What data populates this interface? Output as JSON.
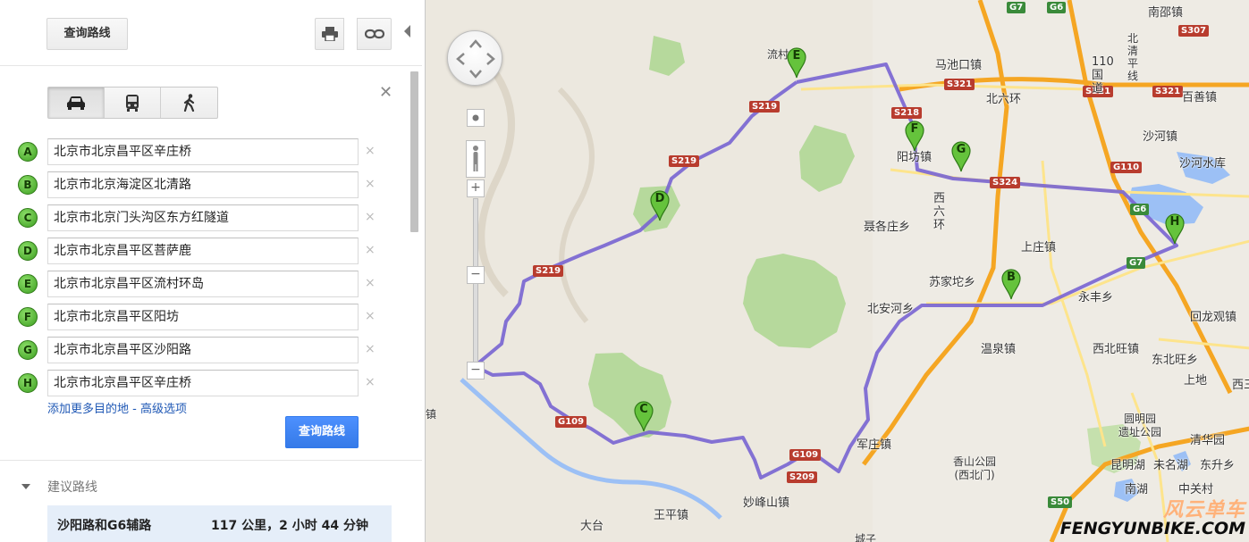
{
  "left_panel": {
    "search_button_top": "查询路线",
    "print_icon": "printer-icon",
    "link_icon": "link-icon",
    "travel_modes": [
      {
        "name": "car-icon",
        "active": true
      },
      {
        "name": "bus-icon",
        "active": false
      },
      {
        "name": "walk-icon",
        "active": false
      }
    ],
    "close_label": "✕",
    "waypoints": [
      {
        "letter": "A",
        "value": "北京市北京昌平区辛庄桥"
      },
      {
        "letter": "B",
        "value": "北京市北京海淀区北清路"
      },
      {
        "letter": "C",
        "value": "北京市北京门头沟区东方红隧道"
      },
      {
        "letter": "D",
        "value": "北京市北京昌平区菩萨鹿"
      },
      {
        "letter": "E",
        "value": "北京市北京昌平区流村环岛"
      },
      {
        "letter": "F",
        "value": "北京市北京昌平区阳坊"
      },
      {
        "letter": "G",
        "value": "北京市北京昌平区沙阳路"
      },
      {
        "letter": "H",
        "value": "北京市北京昌平区辛庄桥"
      }
    ],
    "remove_label": "×",
    "add_destination": "添加更多目的地",
    "separator": " - ",
    "advanced_options": "高级选项",
    "search_button": "查询路线",
    "suggested_routes_title": "建议路线",
    "route": {
      "name": "沙阳路和G6辅路",
      "stats": "117 公里，2 小时 44 分钟"
    }
  },
  "map": {
    "colors": {
      "route": "#7864d2",
      "highway": "#f5a623",
      "arterial": "#fde48c",
      "park": "#b6d99c",
      "water": "#9cc0f5",
      "land": "#ece8df"
    },
    "zoom_plus": "+",
    "zoom_minus_mid": "−",
    "zoom_minus": "−",
    "markers": [
      {
        "letter": "E"
      },
      {
        "letter": "F"
      },
      {
        "letter": "G"
      },
      {
        "letter": "D"
      },
      {
        "letter": "H"
      },
      {
        "letter": "B"
      },
      {
        "letter": "C"
      }
    ],
    "place_labels": [
      "流村",
      "马池口镇",
      "北六环",
      "阳坊镇",
      "聂各庄乡",
      "西六环",
      "上庄镇",
      "苏家坨乡",
      "北安河乡",
      "温泉镇",
      "永丰乡",
      "西北旺镇",
      "东北旺乡",
      "军庄镇",
      "香山公园\n(西北门)",
      "妙峰山镇",
      "王平镇",
      "大台",
      "南邵镇",
      "百善镇",
      "沙河镇",
      "沙河水库",
      "回龙观镇",
      "上地",
      "西三",
      "圆明园\n遗址公园",
      "清华园",
      "昆明湖",
      "未名湖",
      "东升乡",
      "南湖",
      "中关村",
      "110国道",
      "北清平线",
      "镇",
      "城子"
    ],
    "road_shields": [
      "G7",
      "G6",
      "S307",
      "S321",
      "S321",
      "S321",
      "S218",
      "S219",
      "S219",
      "S219",
      "S324",
      "G110",
      "G6",
      "G7",
      "G109",
      "G109",
      "S209",
      "S50"
    ],
    "watermark": {
      "cn": "风云单车",
      "en": "FENGYUNBIKE.COM"
    }
  }
}
